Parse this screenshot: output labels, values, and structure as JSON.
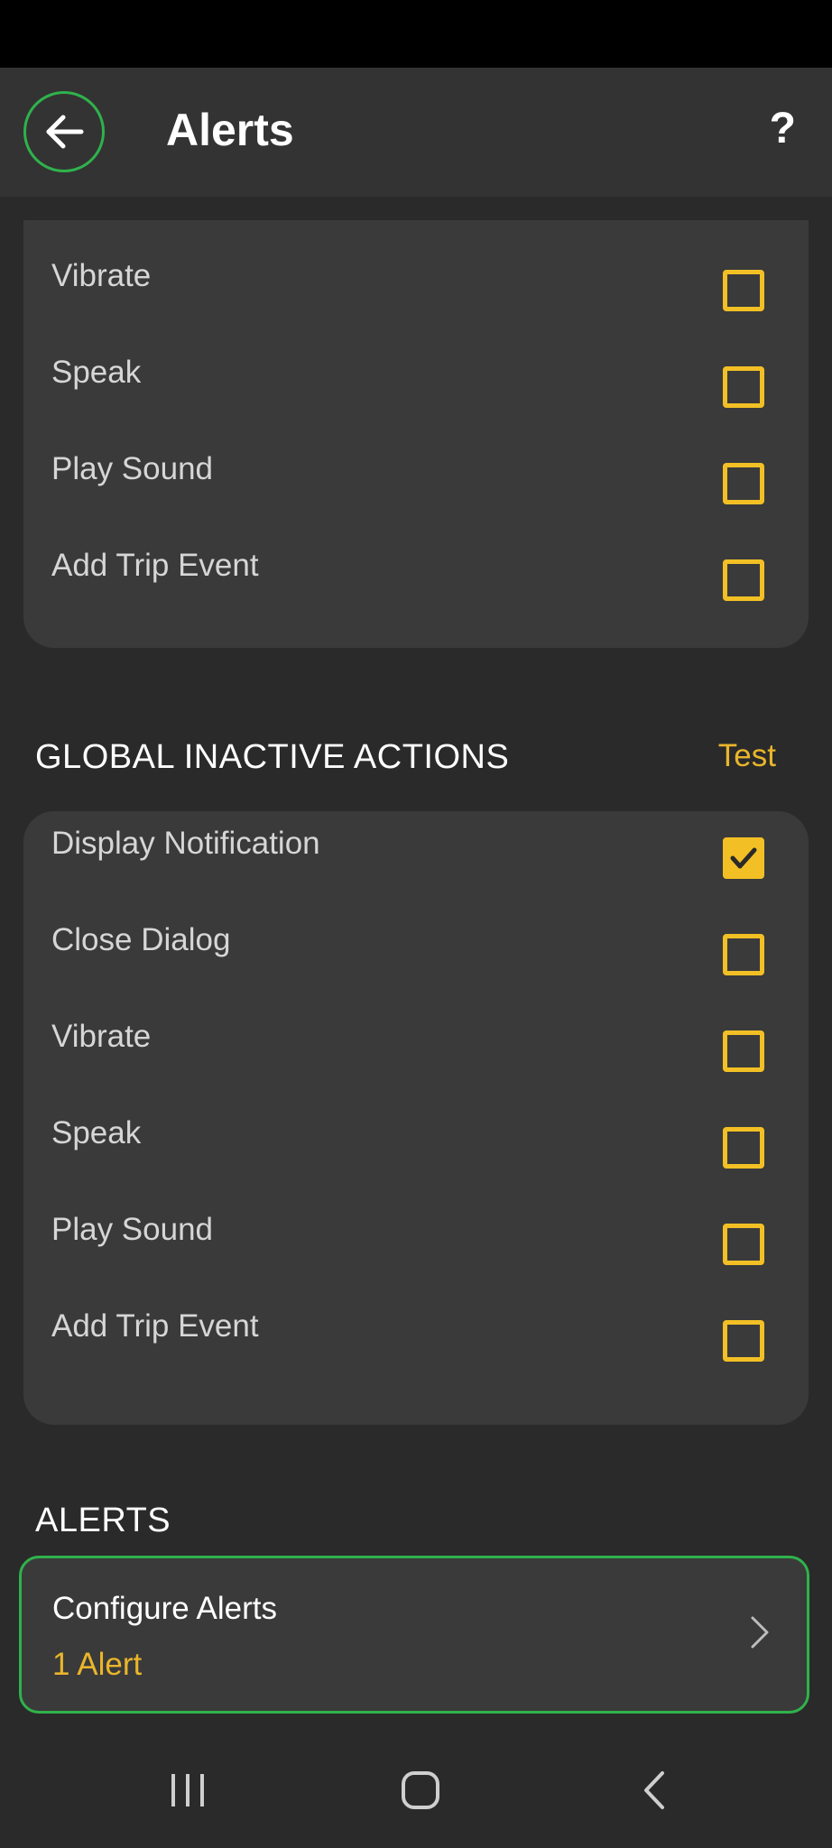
{
  "app_bar": {
    "title": "Alerts",
    "help_label": "?"
  },
  "active_actions": {
    "items": [
      {
        "label": "Vibrate",
        "checked": false
      },
      {
        "label": "Speak",
        "checked": false
      },
      {
        "label": "Play Sound",
        "checked": false
      },
      {
        "label": "Add Trip Event",
        "checked": false
      }
    ]
  },
  "inactive_actions": {
    "header": "GLOBAL INACTIVE ACTIONS",
    "test_label": "Test",
    "items": [
      {
        "label": "Display Notification",
        "checked": true
      },
      {
        "label": "Close Dialog",
        "checked": false
      },
      {
        "label": "Vibrate",
        "checked": false
      },
      {
        "label": "Speak",
        "checked": false
      },
      {
        "label": "Play Sound",
        "checked": false
      },
      {
        "label": "Add Trip Event",
        "checked": false
      }
    ]
  },
  "alerts_section": {
    "header": "ALERTS",
    "configure_title": "Configure Alerts",
    "configure_count": "1 Alert"
  },
  "colors": {
    "accent_yellow": "#f2c025",
    "accent_green": "#2fb24c",
    "card_bg": "#3a3a3a",
    "page_bg": "#2a2a2a"
  }
}
